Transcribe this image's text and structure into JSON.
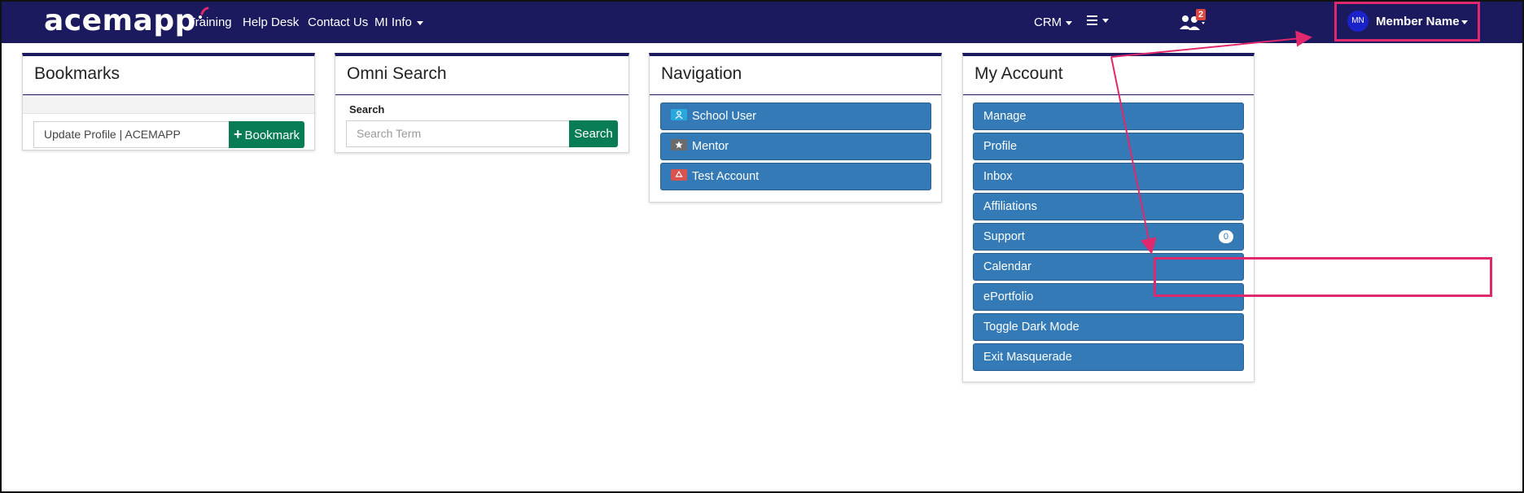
{
  "navbar": {
    "logo": "acemapp",
    "links": [
      "Training",
      "Help Desk",
      "Contact Us",
      "MI Info"
    ],
    "notification_count": "2",
    "crm": "CRM",
    "member_initials": "MN",
    "member_name": "Member Name"
  },
  "bookmarks": {
    "title": "Bookmarks",
    "input_value": "Update Profile | ACEMAPP",
    "button_label": "Bookmark"
  },
  "omni_search": {
    "title": "Omni Search",
    "label": "Search",
    "placeholder": "Search Term",
    "button_label": "Search"
  },
  "navigation": {
    "title": "Navigation",
    "items": [
      {
        "label": "School User",
        "icon": "user-icon",
        "icon_color": "#29a8e0"
      },
      {
        "label": "Mentor",
        "icon": "star-icon",
        "icon_color": "#6b6b6b"
      },
      {
        "label": "Test Account",
        "icon": "recycle-icon",
        "icon_color": "#d9534f"
      }
    ]
  },
  "my_account": {
    "title": "My Account",
    "items": [
      "Manage",
      "Profile",
      "Inbox",
      "Affiliations",
      "Support",
      "Calendar",
      "ePortfolio",
      "Toggle Dark Mode",
      "Exit Masquerade"
    ],
    "support_count": "0"
  },
  "colors": {
    "navbar": "#1b1a5e",
    "button_blue": "#337ab7",
    "button_green": "#077c55",
    "highlight": "#e0286c"
  }
}
